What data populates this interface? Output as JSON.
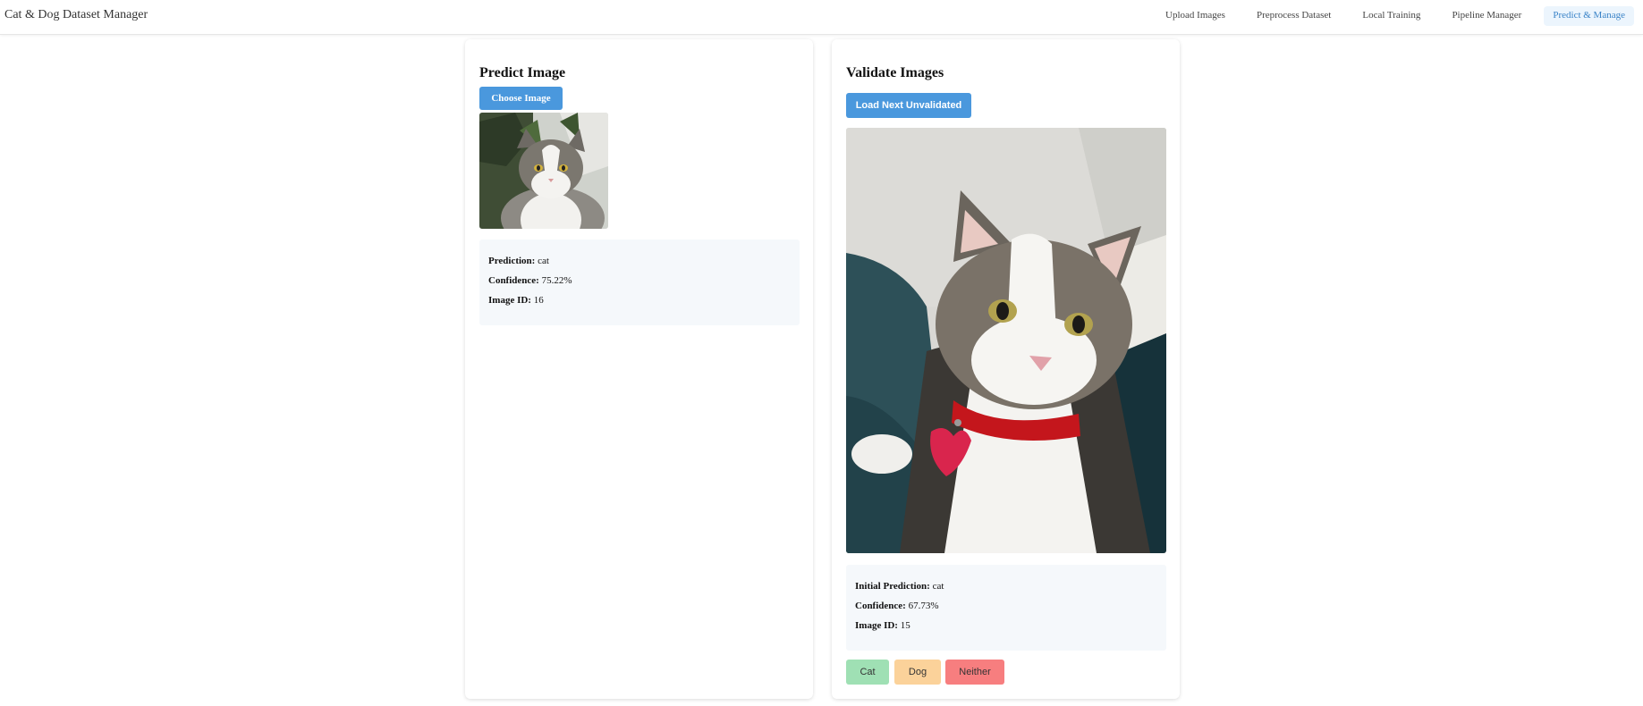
{
  "app": {
    "title": "Cat & Dog Dataset Manager"
  },
  "nav": {
    "items": [
      {
        "label": "Upload Images"
      },
      {
        "label": "Preprocess Dataset"
      },
      {
        "label": "Local Training"
      },
      {
        "label": "Pipeline Manager"
      },
      {
        "label": "Predict & Manage"
      }
    ],
    "active": "Predict & Manage"
  },
  "predict": {
    "title": "Predict Image",
    "choose_label": "Choose Image",
    "result": {
      "prediction_label": "Prediction:",
      "prediction_value": "cat",
      "confidence_label": "Confidence:",
      "confidence_value": "75.22%",
      "image_id_label": "Image ID:",
      "image_id_value": "16"
    }
  },
  "validate": {
    "title": "Validate Images",
    "load_label": "Load Next Unvalidated",
    "result": {
      "prediction_label": "Initial Prediction:",
      "prediction_value": "cat",
      "confidence_label": "Confidence:",
      "confidence_value": "67.73%",
      "image_id_label": "Image ID:",
      "image_id_value": "15"
    },
    "buttons": {
      "cat": "Cat",
      "dog": "Dog",
      "neither": "Neither"
    }
  },
  "colors": {
    "primary": "#4a98dd",
    "active_nav_bg": "#ecf5fd",
    "active_nav_text": "#3b84c8",
    "result_bg": "#f5f8fb",
    "cat_btn": "#9fe0b4",
    "dog_btn": "#fbd29a",
    "neither_btn": "#f77e7f"
  }
}
